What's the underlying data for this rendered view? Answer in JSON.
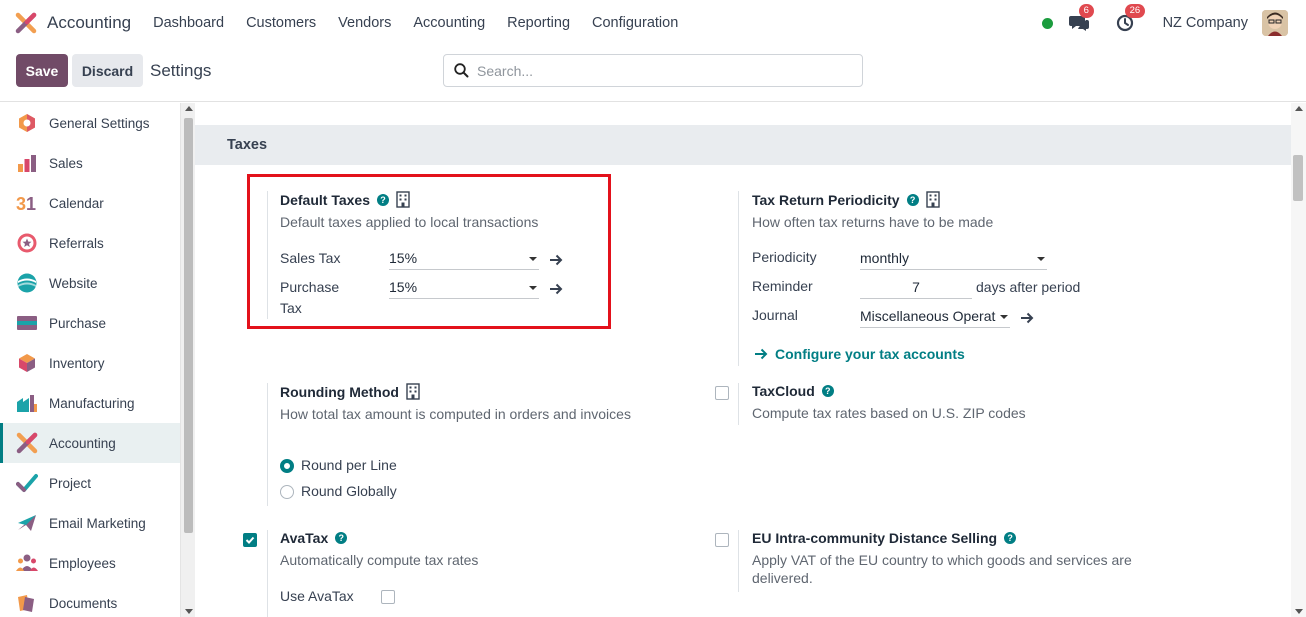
{
  "app": {
    "name": "Accounting"
  },
  "topnav": {
    "menu": [
      "Dashboard",
      "Customers",
      "Vendors",
      "Accounting",
      "Reporting",
      "Configuration"
    ],
    "messages_badge": "6",
    "activities_badge": "26",
    "company": "NZ Company"
  },
  "controlbar": {
    "save_label": "Save",
    "discard_label": "Discard",
    "breadcrumb": "Settings",
    "search_placeholder": "Search..."
  },
  "sidebar": {
    "items": [
      {
        "label": "General Settings",
        "icon": "general-settings-icon"
      },
      {
        "label": "Sales",
        "icon": "sales-icon"
      },
      {
        "label": "Calendar",
        "icon": "calendar-icon"
      },
      {
        "label": "Referrals",
        "icon": "referrals-icon"
      },
      {
        "label": "Website",
        "icon": "website-icon"
      },
      {
        "label": "Purchase",
        "icon": "purchase-icon"
      },
      {
        "label": "Inventory",
        "icon": "inventory-icon"
      },
      {
        "label": "Manufacturing",
        "icon": "manufacturing-icon"
      },
      {
        "label": "Accounting",
        "icon": "accounting-icon",
        "active": true
      },
      {
        "label": "Project",
        "icon": "project-icon"
      },
      {
        "label": "Email Marketing",
        "icon": "email-marketing-icon"
      },
      {
        "label": "Employees",
        "icon": "employees-icon"
      },
      {
        "label": "Documents",
        "icon": "documents-icon"
      }
    ]
  },
  "section": {
    "title": "Taxes"
  },
  "default_taxes": {
    "title": "Default Taxes",
    "desc": "Default taxes applied to local transactions",
    "sales_tax_label": "Sales Tax",
    "sales_tax_value": "15%",
    "purchase_tax_label_1": "Purchase",
    "purchase_tax_label_2": "Tax",
    "purchase_tax_value": "15%"
  },
  "tax_return": {
    "title": "Tax Return Periodicity",
    "desc": "How often tax returns have to be made",
    "periodicity_label": "Periodicity",
    "periodicity_value": "monthly",
    "reminder_label": "Reminder",
    "reminder_value": "7",
    "reminder_suffix": "days after period",
    "journal_label": "Journal",
    "journal_value": "Miscellaneous Operat",
    "configure_link": "Configure your tax accounts"
  },
  "rounding": {
    "title": "Rounding Method",
    "desc": "How total tax amount is computed in orders and invoices",
    "option_line": "Round per Line",
    "option_global": "Round Globally",
    "selected": "Round per Line"
  },
  "taxcloud": {
    "title": "TaxCloud",
    "desc": "Compute tax rates based on U.S. ZIP codes",
    "checked": false
  },
  "avatax": {
    "title": "AvaTax",
    "desc": "Automatically compute tax rates",
    "use_label": "Use AvaTax",
    "checked": true
  },
  "eu_distance": {
    "title": "EU Intra-community Distance Selling",
    "desc_1": "Apply VAT of the EU country to which goods and services are",
    "desc_2": "delivered.",
    "checked": false
  },
  "colors": {
    "brand": "#714b67",
    "accent": "#017e84",
    "highlight": "#e3111b"
  }
}
